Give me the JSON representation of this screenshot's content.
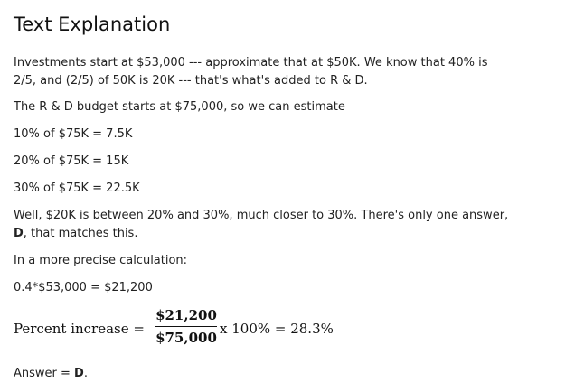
{
  "heading": "Text Explanation",
  "paragraphs": {
    "p1_line1": "Investments start at $53,000 --- approximate that at $50K.  We know that 40% is",
    "p1_line2": "2/5, and (2/5) of 50K is 20K --- that's what's added to R & D.",
    "p2": "The R & D budget starts at $75,000, so we can estimate",
    "p3": "10% of $75K = 7.5K",
    "p4": "20% of $75K = 15K",
    "p5": "30% of $75K = 22.5K",
    "p6_line1": "Well, $20K is between 20% and 30%, much closer to 30%.  There's only one answer,",
    "p6_line2_bold": "D",
    "p6_line2_rest": ", that matches this.",
    "p7": "In a more precise calculation:",
    "p8": "0.4*$53,000 = $21,200"
  },
  "formula": {
    "lhs": "Percent increase =",
    "numerator": "$21,200",
    "denominator": "$75,000",
    "rhs": "x 100% = 28.3%"
  },
  "answer": {
    "prefix": "Answer = ",
    "letter": "D",
    "suffix": "."
  }
}
